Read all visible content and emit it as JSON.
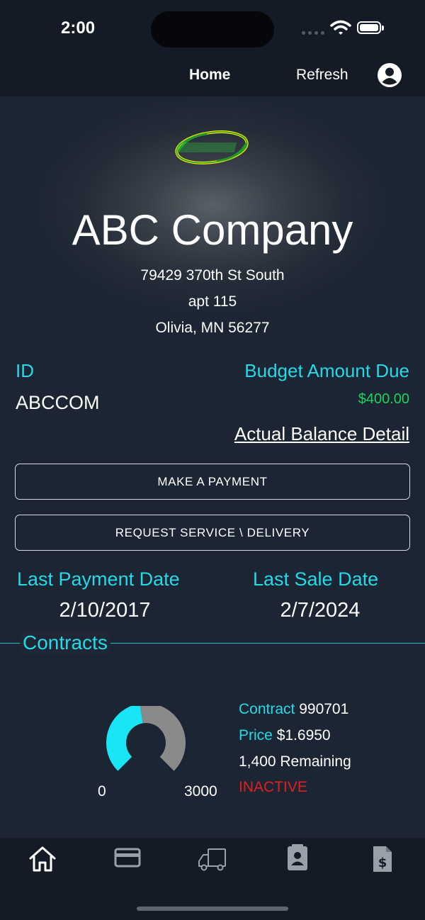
{
  "status": {
    "time": "2:00"
  },
  "nav": {
    "home_label": "Home",
    "refresh_label": "Refresh"
  },
  "company": {
    "name": "ABC Company",
    "address_line1": "79429 370th St South",
    "address_line2": "apt 115",
    "address_line3": "Olivia, MN 56277"
  },
  "account": {
    "id_label": "ID",
    "id_value": "ABCCOM",
    "budget_label": "Budget Amount Due",
    "budget_value": "$400.00",
    "balance_link": "Actual Balance Detail"
  },
  "actions": {
    "make_payment": "MAKE A PAYMENT",
    "request_service": "REQUEST SERVICE \\ DELIVERY"
  },
  "dates": {
    "last_payment_label": "Last Payment Date",
    "last_payment_value": "2/10/2017",
    "last_sale_label": "Last Sale Date",
    "last_sale_value": "2/7/2024"
  },
  "contracts": {
    "title": "Contracts",
    "gauge": {
      "min": "0",
      "max": "3000",
      "min_value": 0,
      "max_value": 3000,
      "remaining_value": 1400
    },
    "contract_label": "Contract",
    "contract_value": "990701",
    "price_label": "Price",
    "price_value": "$1.6950",
    "remaining": "1,400 Remaining",
    "status": "INACTIVE"
  },
  "tabs": [
    "home-icon",
    "credit-card-icon",
    "truck-icon",
    "contact-card-icon",
    "invoice-dollar-icon"
  ],
  "colors": {
    "accent": "#25d9e8",
    "amount": "#1bd55a",
    "inactive": "#e0201f",
    "gauge_fill": "#19e6f5",
    "gauge_track": "#8a8a8a"
  }
}
